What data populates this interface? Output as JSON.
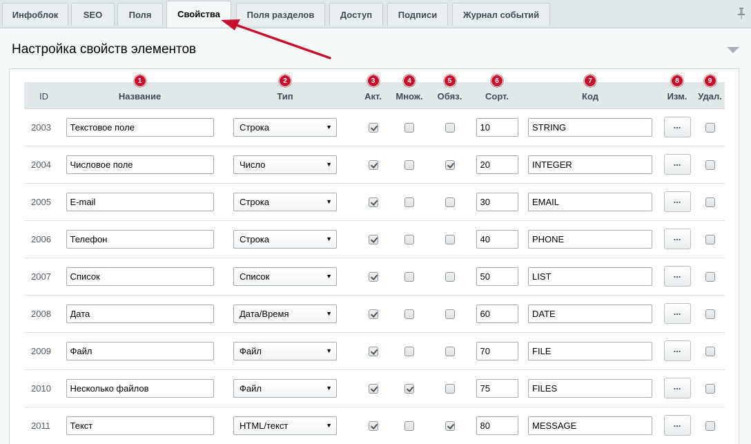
{
  "tabs": [
    {
      "label": "Инфоблок",
      "active": false
    },
    {
      "label": "SEO",
      "active": false
    },
    {
      "label": "Поля",
      "active": false
    },
    {
      "label": "Свойства",
      "active": true
    },
    {
      "label": "Поля разделов",
      "active": false
    },
    {
      "label": "Доступ",
      "active": false
    },
    {
      "label": "Подписи",
      "active": false
    },
    {
      "label": "Журнал событий",
      "active": false
    }
  ],
  "panel": {
    "title": "Настройка свойств элементов"
  },
  "columns": {
    "id": "ID",
    "name": "Название",
    "type": "Тип",
    "active": "Акт.",
    "multiple": "Множ.",
    "required": "Обяз.",
    "sort": "Сорт.",
    "code": "Код",
    "edit": "Изм.",
    "delete": "Удал."
  },
  "badges": [
    "1",
    "2",
    "3",
    "4",
    "5",
    "6",
    "7",
    "8",
    "9"
  ],
  "edit_button_label": "...",
  "rows": [
    {
      "id": "2003",
      "name": "Текстовое поле",
      "type": "Строка",
      "active": true,
      "multiple": false,
      "required": false,
      "sort": "10",
      "code": "STRING",
      "delete": false
    },
    {
      "id": "2004",
      "name": "Числовое поле",
      "type": "Число",
      "active": true,
      "multiple": false,
      "required": true,
      "sort": "20",
      "code": "INTEGER",
      "delete": false
    },
    {
      "id": "2005",
      "name": "E-mail",
      "type": "Строка",
      "active": true,
      "multiple": false,
      "required": false,
      "sort": "30",
      "code": "EMAIL",
      "delete": false
    },
    {
      "id": "2006",
      "name": "Телефон",
      "type": "Строка",
      "active": true,
      "multiple": false,
      "required": false,
      "sort": "40",
      "code": "PHONE",
      "delete": false
    },
    {
      "id": "2007",
      "name": "Список",
      "type": "Список",
      "active": true,
      "multiple": false,
      "required": false,
      "sort": "50",
      "code": "LIST",
      "delete": false
    },
    {
      "id": "2008",
      "name": "Дата",
      "type": "Дата/Время",
      "active": true,
      "multiple": false,
      "required": false,
      "sort": "60",
      "code": "DATE",
      "delete": false
    },
    {
      "id": "2009",
      "name": "Файл",
      "type": "Файл",
      "active": true,
      "multiple": false,
      "required": false,
      "sort": "70",
      "code": "FILE",
      "delete": false
    },
    {
      "id": "2010",
      "name": "Несколько файлов",
      "type": "Файл",
      "active": true,
      "multiple": true,
      "required": false,
      "sort": "75",
      "code": "FILES",
      "delete": false
    },
    {
      "id": "2011",
      "name": "Текст",
      "type": "HTML/текст",
      "active": true,
      "multiple": false,
      "required": true,
      "sort": "80",
      "code": "MESSAGE",
      "delete": false
    }
  ],
  "colors": {
    "badge": "#c8102e",
    "arrow": "#c8102e",
    "header_bg": "#e1e9ea",
    "page_bg": "#e0e8ea"
  }
}
